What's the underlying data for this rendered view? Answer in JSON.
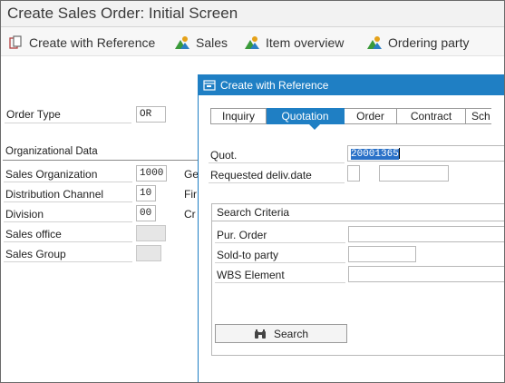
{
  "window": {
    "title": "Create Sales Order: Initial Screen"
  },
  "toolbar": {
    "create_with_reference": "Create with Reference",
    "sales": "Sales",
    "item_overview": "Item overview",
    "ordering_party": "Ordering party"
  },
  "main": {
    "order_type": {
      "label": "Order Type",
      "value": "OR"
    },
    "org_data_title": "Organizational Data",
    "sales_org": {
      "label": "Sales Organization",
      "value": "1000",
      "extra": "Ge"
    },
    "dist_channel": {
      "label": "Distribution Channel",
      "value": "10",
      "extra": "Fir"
    },
    "division": {
      "label": "Division",
      "value": "00",
      "extra": "Cr"
    },
    "sales_office": {
      "label": "Sales office",
      "value": ""
    },
    "sales_group": {
      "label": "Sales Group",
      "value": ""
    }
  },
  "dialog": {
    "title": "Create with Reference",
    "tabs": [
      "Inquiry",
      "Quotation",
      "Order",
      "Contract",
      "Sch"
    ],
    "active_tab": "Quotation",
    "quot": {
      "label": "Quot.",
      "value": "20001365"
    },
    "req_deliv_date": {
      "label": "Requested deliv.date",
      "value": ""
    },
    "search_criteria": {
      "title": "Search Criteria",
      "pur_order": {
        "label": "Pur. Order",
        "value": ""
      },
      "sold_to": {
        "label": "Sold-to party",
        "value": ""
      },
      "wbs": {
        "label": "WBS Element",
        "value": ""
      }
    },
    "search_button": "Search"
  },
  "colors": {
    "accent": "#1f7fc4",
    "selection": "#2a71c8"
  },
  "icons": [
    "create-reference-icon",
    "sales-icon",
    "item-overview-icon",
    "ordering-party-icon",
    "dialog-icon",
    "binoculars-icon"
  ]
}
